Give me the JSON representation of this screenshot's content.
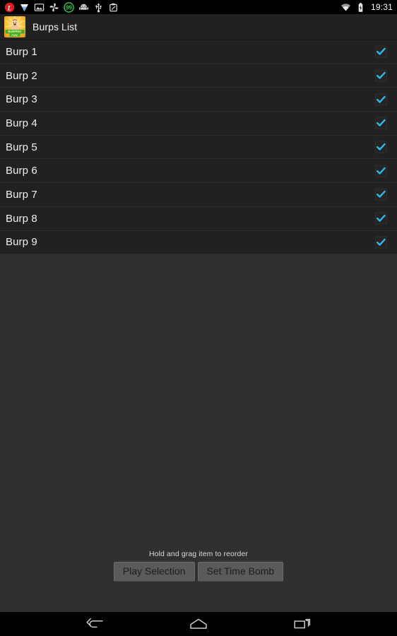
{
  "status_bar": {
    "left_icons": [
      {
        "name": "lastpass-icon",
        "glyph": "L"
      },
      {
        "name": "shield-icon",
        "glyph": ""
      },
      {
        "name": "image-icon",
        "glyph": ""
      },
      {
        "name": "pinwheel-icon",
        "glyph": ""
      },
      {
        "name": "notification-count-badge",
        "glyph": "99"
      },
      {
        "name": "android-robot-icon",
        "glyph": ""
      },
      {
        "name": "usb-icon",
        "glyph": ""
      },
      {
        "name": "screenshot-clipboard-icon",
        "glyph": ""
      }
    ],
    "wifi_icon": "wifi-icon",
    "battery_icon": "battery-charging-icon",
    "time": "19:31"
  },
  "header": {
    "app_icon_name": "burping-fun-app-icon",
    "app_icon_text": "BURPING FUN!",
    "title": "Burps List"
  },
  "list": {
    "items": [
      {
        "label": "Burp 1",
        "checked": true
      },
      {
        "label": "Burp 2",
        "checked": true
      },
      {
        "label": "Burp 3",
        "checked": true
      },
      {
        "label": "Burp 4",
        "checked": true
      },
      {
        "label": "Burp 5",
        "checked": true
      },
      {
        "label": "Burp 6",
        "checked": true
      },
      {
        "label": "Burp 7",
        "checked": true
      },
      {
        "label": "Burp 8",
        "checked": true
      },
      {
        "label": "Burp 9",
        "checked": true
      }
    ]
  },
  "footer": {
    "hint": "Hold and grag item to reorder",
    "play_button": "Play Selection",
    "bomb_button": "Set Time Bomb"
  },
  "nav_bar": {
    "back": "back-icon",
    "home": "home-icon",
    "recents": "recents-icon"
  },
  "colors": {
    "accent_check": "#33B5E5",
    "list_bg": "#212121",
    "page_bg": "#303030",
    "button_bg": "#5a5a5a"
  }
}
